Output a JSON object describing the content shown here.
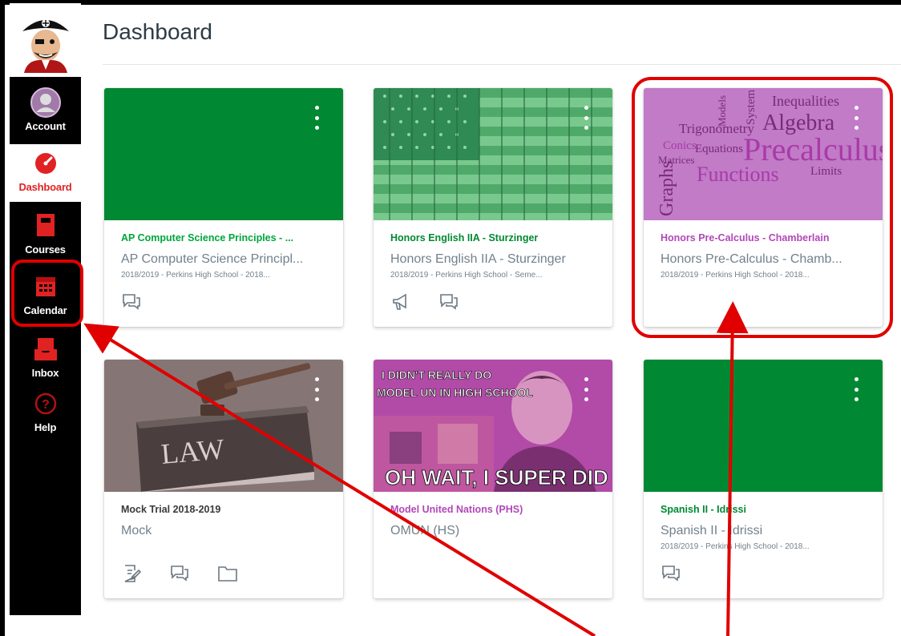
{
  "page": {
    "title": "Dashboard"
  },
  "nav": {
    "logo": "school-mascot-logo",
    "items": [
      {
        "label": "Account",
        "icon": "account-icon"
      },
      {
        "label": "Dashboard",
        "icon": "dashboard-icon",
        "active": true
      },
      {
        "label": "Courses",
        "icon": "courses-icon"
      },
      {
        "label": "Calendar",
        "icon": "calendar-icon"
      },
      {
        "label": "Inbox",
        "icon": "inbox-icon"
      },
      {
        "label": "Help",
        "icon": "help-icon"
      }
    ]
  },
  "colors": {
    "green": "#008932",
    "purple": "#b65dbb",
    "gray_overlay": "#6b5a5a",
    "accent_red": "#e12222",
    "annotation_red": "#e00000"
  },
  "cards": [
    {
      "title": "AP Computer Science Principles - ...",
      "code": "AP Computer Science Principl...",
      "term": "2018/2019 - Perkins High School - 2018...",
      "title_color": "#00a63c",
      "hero": "green",
      "actions": [
        "discussions-icon"
      ]
    },
    {
      "title": "Honors English IIA - Sturzinger",
      "code": "Honors English IIA - Sturzinger",
      "term": "2018/2019 - Perkins High School - Seme...",
      "title_color": "#008932",
      "hero": "flag-image",
      "actions": [
        "announcements-icon",
        "discussions-icon"
      ]
    },
    {
      "title": "Honors Pre-Calculus - Chamberlain",
      "code": "Honors Pre-Calculus - Chamb...",
      "term": "2018/2019 - Perkins High School - 2018...",
      "title_color": "#b148b8",
      "hero": "word-cloud-image",
      "actions": [],
      "hero_words": [
        "Inequalities",
        "Algebra",
        "Trigonometry",
        "Conics",
        "Equations",
        "Precalculus",
        "Matrices",
        "Functions",
        "Limits",
        "Graphs",
        "System",
        "Models"
      ]
    },
    {
      "title": "Mock Trial 2018-2019",
      "code": "Mock",
      "term": "",
      "title_color": "#3a3a3a",
      "hero": "gavel-image",
      "hero_text": "LAW",
      "actions": [
        "assignments-icon",
        "discussions-icon",
        "files-icon"
      ]
    },
    {
      "title": "Model United Nations (PHS)",
      "code": "OMUN (HS)",
      "term": "",
      "title_color": "#b148b8",
      "hero": "meme-image",
      "hero_top_text": "I DIDN'T REALLY DO\nMODEL UN IN HIGH SCHOOL",
      "hero_bottom_text": "OH WAIT, I SUPER DID",
      "actions": []
    },
    {
      "title": "Spanish II - Idrissi",
      "code": "Spanish II - Idrissi",
      "term": "2018/2019 - Perkins High School - 2018...",
      "title_color": "#008932",
      "hero": "green",
      "actions": [
        "discussions-icon"
      ]
    }
  ]
}
